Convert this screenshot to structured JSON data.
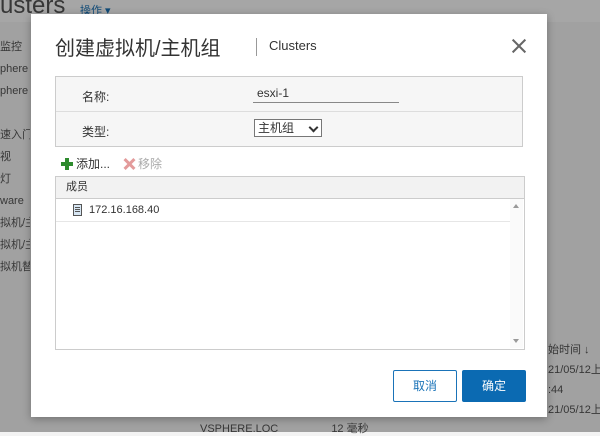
{
  "background": {
    "title": "usters",
    "ops_label": "操作 ▾",
    "left_items": [
      "监控",
      "phere",
      "phere",
      "",
      "速入门",
      "视",
      "灯",
      "ware",
      "拟机/主",
      "拟机/主",
      "拟机替"
    ],
    "right_items": [
      "",
      "",
      "",
      "",
      "",
      "",
      "",
      "",
      "",
      "始时间 ↓",
      "21/05/12上",
      ":44",
      "21/05/12上"
    ],
    "bottom_items": [
      "VSPHERE.LOC",
      "12 毫秒"
    ]
  },
  "dialog": {
    "title": "创建虚拟机/主机组",
    "subtitle": "Clusters",
    "form": {
      "name_label": "名称:",
      "name_value": "esxi-1",
      "type_label": "类型:",
      "type_value": "主机组"
    },
    "toolbar": {
      "add_label": "添加...",
      "remove_label": "移除"
    },
    "grid": {
      "column_header": "成员",
      "rows": [
        "172.16.168.40"
      ]
    },
    "buttons": {
      "cancel": "取消",
      "ok": "确定"
    }
  }
}
